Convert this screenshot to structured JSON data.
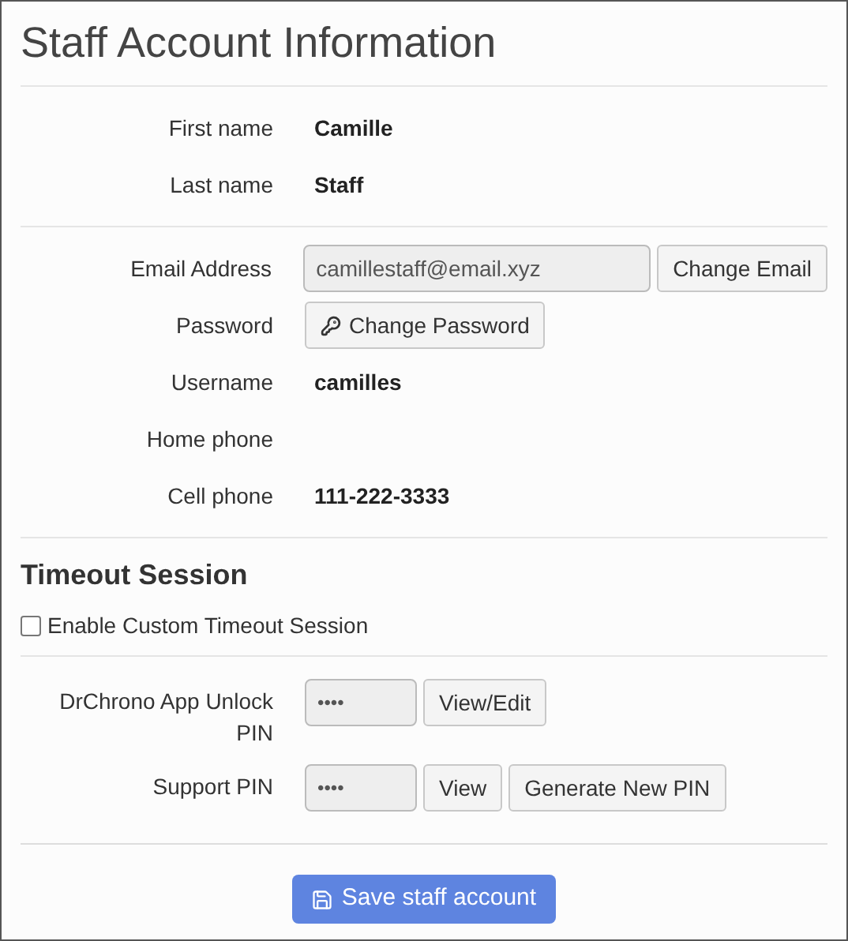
{
  "title": "Staff Account Information",
  "sections": [
    {
      "rows": [
        {
          "label": "First name",
          "kind": "text",
          "value": "Camille"
        },
        {
          "label": "Last name",
          "kind": "text",
          "value": "Staff"
        }
      ]
    },
    {
      "rows": [
        {
          "label": "Email Address",
          "kind": "field",
          "value": "camillestaff@email.xyz",
          "buttons": [
            {
              "label": "Change Email"
            }
          ]
        },
        {
          "label": "Password",
          "kind": "buttons",
          "buttons": [
            {
              "label": "Change Password",
              "kind": "key"
            }
          ]
        },
        {
          "label": "Username",
          "kind": "text",
          "value": "camilles"
        },
        {
          "label": "Home phone",
          "kind": "text"
        },
        {
          "label": "Cell phone",
          "kind": "text",
          "value": "111-222-3333"
        }
      ]
    }
  ],
  "timeout": {
    "heading": "Timeout Session",
    "checkbox": {
      "label": "Enable Custom Timeout Session",
      "checked": false
    }
  },
  "pins": [
    {
      "label": "DrChrono App Unlock PIN",
      "kind": "pin",
      "value": "••••",
      "buttons": [
        {
          "label": "View/Edit"
        }
      ]
    },
    {
      "label": "Support PIN",
      "kind": "pin",
      "value": "••••",
      "buttons": [
        {
          "label": "View"
        },
        {
          "label": "Generate New PIN"
        }
      ]
    }
  ],
  "save_button": {
    "label": "Save staff account"
  }
}
